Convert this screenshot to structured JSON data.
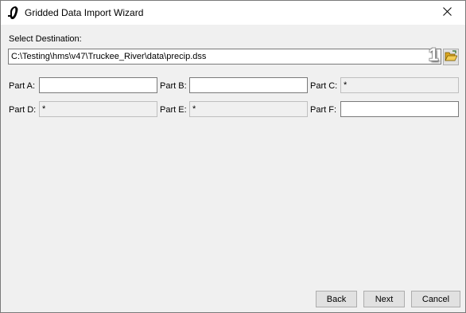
{
  "window": {
    "title": "Gridded Data Import Wizard",
    "icon": "hms-app-icon",
    "close_icon": "close-icon"
  },
  "destination": {
    "label": "Select Destination:",
    "value": "C:\\Testing\\hms\\v47\\Truckee_River\\data\\precip.dss",
    "browse_icon": "open-folder-icon",
    "annotation": "1"
  },
  "parts": [
    {
      "label": "Part A:",
      "value": "",
      "enabled": true
    },
    {
      "label": "Part B:",
      "value": "",
      "enabled": true
    },
    {
      "label": "Part C:",
      "value": "*",
      "enabled": false
    },
    {
      "label": "Part D:",
      "value": "*",
      "enabled": false
    },
    {
      "label": "Part E:",
      "value": "*",
      "enabled": false
    },
    {
      "label": "Part F:",
      "value": "",
      "enabled": true
    }
  ],
  "buttons": {
    "back": "Back",
    "next": "Next",
    "cancel": "Cancel"
  }
}
